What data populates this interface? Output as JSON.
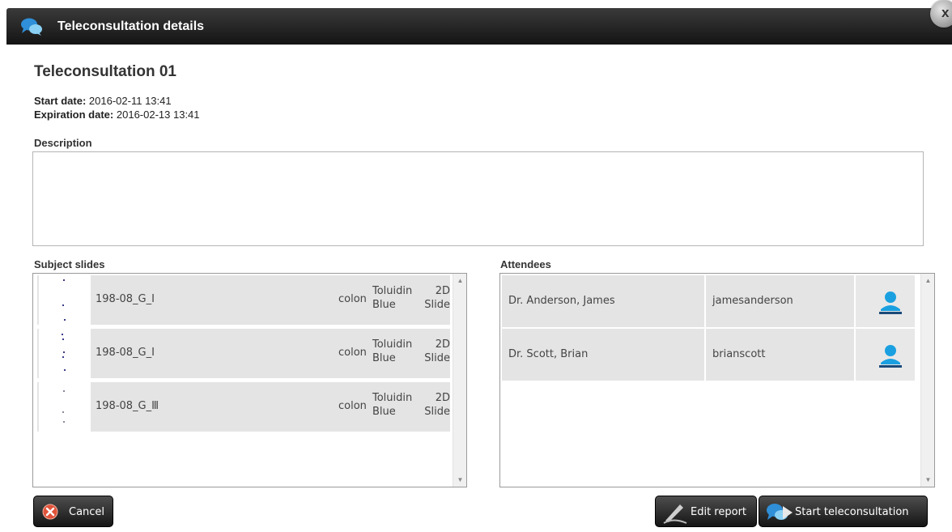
{
  "window": {
    "title": "Teleconsultation details",
    "close_glyph": "x"
  },
  "consultation": {
    "title": "Teleconsultation 01",
    "start_label": "Start date:",
    "start_value": "2016-02-11 13:41",
    "expiration_label": "Expiration date:",
    "expiration_value": "2016-02-13 13:41"
  },
  "description": {
    "label": "Description",
    "value": ""
  },
  "slides": {
    "label": "Subject slides",
    "items": [
      {
        "name": "198-08_G_I",
        "organ": "colon",
        "stain_line1": "Toluidin",
        "stain_line2": "Blue",
        "type_line1": "2D",
        "type_line2": "Slide"
      },
      {
        "name": "198-08_G_I",
        "organ": "colon",
        "stain_line1": "Toluidin",
        "stain_line2": "Blue",
        "type_line1": "2D",
        "type_line2": "Slide"
      },
      {
        "name": "198-08_G_Ⅲ",
        "organ": "colon",
        "stain_line1": "Toluidin",
        "stain_line2": "Blue",
        "type_line1": "2D",
        "type_line2": "Slide"
      }
    ]
  },
  "attendees": {
    "label": "Attendees",
    "items": [
      {
        "name": "Dr. Anderson, James",
        "username": "jamesanderson",
        "icon": "user-icon"
      },
      {
        "name": "Dr. Scott, Brian",
        "username": "brianscott",
        "icon": "user-icon"
      }
    ]
  },
  "buttons": {
    "cancel": "Cancel",
    "edit_report": "Edit report",
    "start_teleconsultation": "Start teleconsultation"
  },
  "colors": {
    "titlebar": "#1e1e1e",
    "accent_blue": "#1a8fd6",
    "cancel_red": "#d9452b"
  }
}
